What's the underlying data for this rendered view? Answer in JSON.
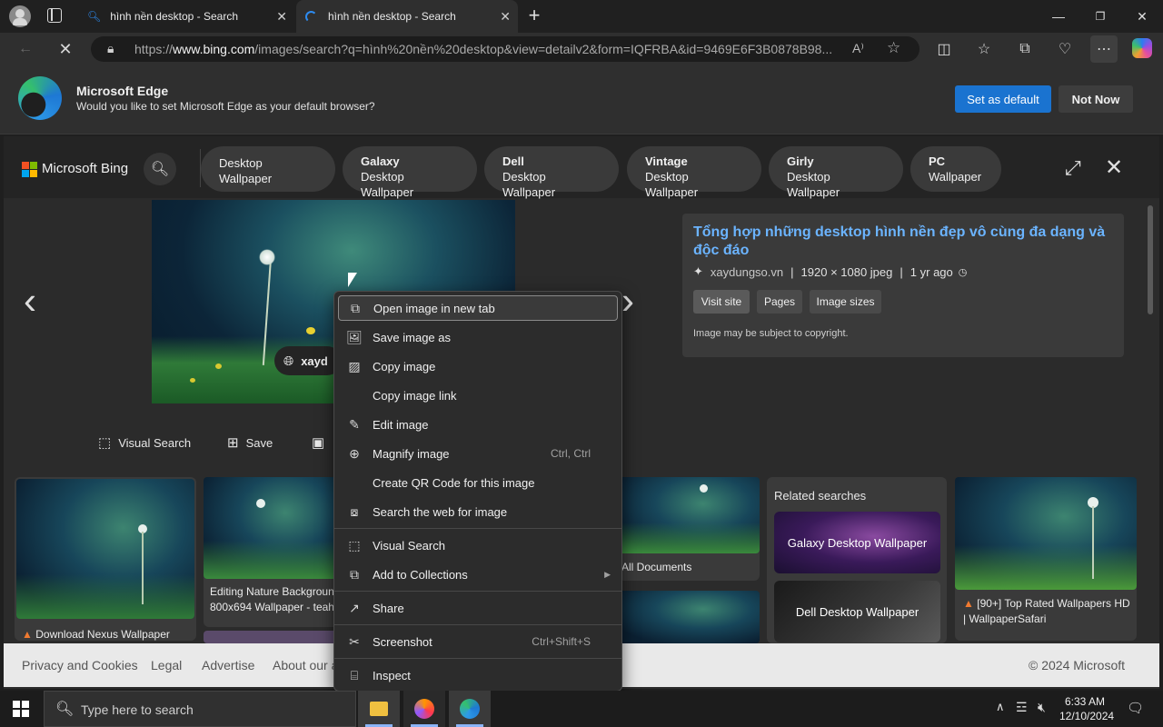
{
  "tabs": [
    {
      "title": "hình nền desktop - Search",
      "close": "✕"
    },
    {
      "title": "hình nền desktop - Search",
      "close": "✕"
    }
  ],
  "new_tab": "+",
  "address": {
    "url_prefix": "https://",
    "url_host": "www.bing.com",
    "url_path": "/images/search?q=hình%20nền%20desktop&view=detailv2&form=IQFRBA&id=9469E6F3B0878B98..."
  },
  "banner": {
    "title": "Microsoft Edge",
    "message": "Would you like to set Microsoft Edge as your default browser?",
    "set_default": "Set as default",
    "not_now": "Not Now"
  },
  "bing": {
    "logo_text": "Microsoft Bing",
    "pills": [
      {
        "top": "",
        "bottom": "Desktop Wallpaper"
      },
      {
        "top": "Galaxy",
        "bottom": "Desktop Wallpaper"
      },
      {
        "top": "Dell",
        "bottom": "Desktop Wallpaper"
      },
      {
        "top": "Vintage",
        "bottom": "Desktop Wallpaper"
      },
      {
        "top": "Girly",
        "bottom": "Desktop Wallpaper"
      },
      {
        "top": "PC",
        "bottom": "Wallpaper"
      }
    ]
  },
  "viewer": {
    "source_badge": "xayd",
    "actions": {
      "visual_search": "Visual Search",
      "save": "Save"
    },
    "info": {
      "title": "Tổng hợp những desktop hình nền đẹp vô cùng đa dạng và độc đáo",
      "source": "xaydungso.vn",
      "dims": "1920 × 1080 jpeg",
      "age": "1 yr ago",
      "sep": "|",
      "btn_visit": "Visit site",
      "btn_pages": "Pages",
      "btn_sizes": "Image sizes",
      "copyright": "Image may be subject to copyright."
    }
  },
  "results": {
    "cap1": "Download Nexus Wallpaper",
    "cap2_line1": "Editing Nature Backgroun",
    "cap2_line2": "800x694 Wallpaper - teah",
    "cap3": "All Documents",
    "related_title": "Related searches",
    "related_1": "Galaxy Desktop Wallpaper",
    "related_2": "Dell Desktop Wallpaper",
    "cap4_line1": "[90+] Top Rated Wallpapers HD",
    "cap4_line2": "| WallpaperSafari"
  },
  "footer": {
    "privacy": "Privacy and Cookies",
    "legal": "Legal",
    "advertise": "Advertise",
    "about": "About our a",
    "copyright": "© 2024 Microsoft"
  },
  "context_menu": {
    "items": [
      {
        "label": "Open image in new tab",
        "shortcut": ""
      },
      {
        "label": "Save image as",
        "shortcut": ""
      },
      {
        "label": "Copy image",
        "shortcut": ""
      },
      {
        "label": "Copy image link",
        "shortcut": ""
      },
      {
        "label": "Edit image",
        "shortcut": ""
      },
      {
        "label": "Magnify image",
        "shortcut": "Ctrl, Ctrl"
      },
      {
        "label": "Create QR Code for this image",
        "shortcut": ""
      },
      {
        "label": "Search the web for image",
        "shortcut": ""
      },
      {
        "label": "Visual Search",
        "shortcut": ""
      },
      {
        "label": "Add to Collections",
        "shortcut": ""
      },
      {
        "label": "Share",
        "shortcut": ""
      },
      {
        "label": "Screenshot",
        "shortcut": "Ctrl+Shift+S"
      },
      {
        "label": "Inspect",
        "shortcut": ""
      }
    ]
  },
  "taskbar": {
    "search_placeholder": "Type here to search",
    "time": "6:33 AM",
    "date": "12/10/2024"
  }
}
